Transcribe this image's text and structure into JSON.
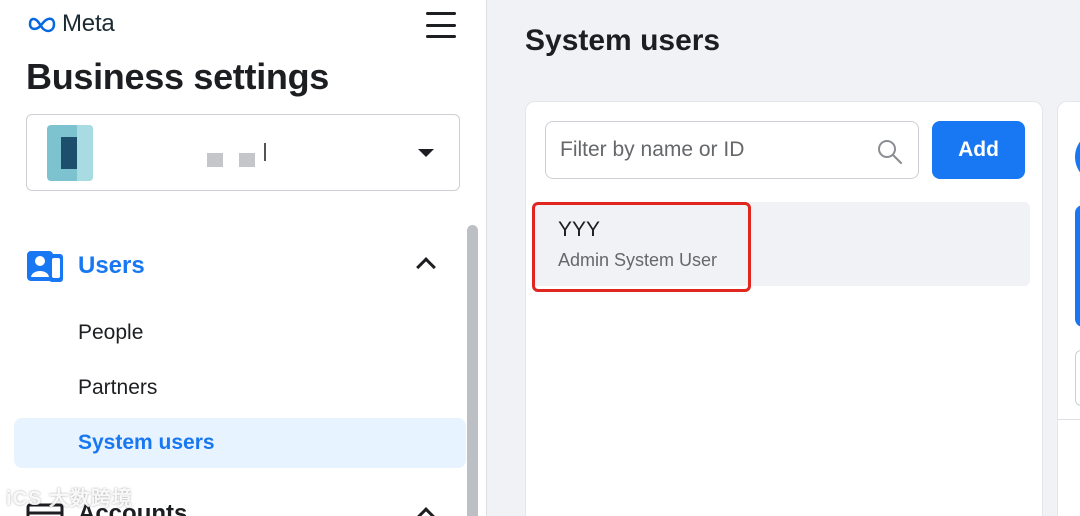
{
  "brand": {
    "logo_text": "Meta"
  },
  "sidebar": {
    "title": "Business settings",
    "account": {
      "name_visible": "l"
    },
    "section": {
      "label": "Users",
      "items": [
        {
          "label": "People",
          "active": false
        },
        {
          "label": "Partners",
          "active": false
        },
        {
          "label": "System users",
          "active": true
        }
      ]
    },
    "next_section": {
      "label": "Accounts"
    }
  },
  "main": {
    "title": "System users",
    "search": {
      "placeholder": "Filter by name or ID",
      "value": ""
    },
    "add_label": "Add",
    "users": [
      {
        "name": "YYY",
        "role": "Admin System User",
        "selected": true
      }
    ]
  },
  "watermark": {
    "text": "iCS 大数跨境"
  },
  "colors": {
    "accent": "#1877f2",
    "highlight": "#e0261f",
    "active_bg": "#e7f3ff"
  }
}
